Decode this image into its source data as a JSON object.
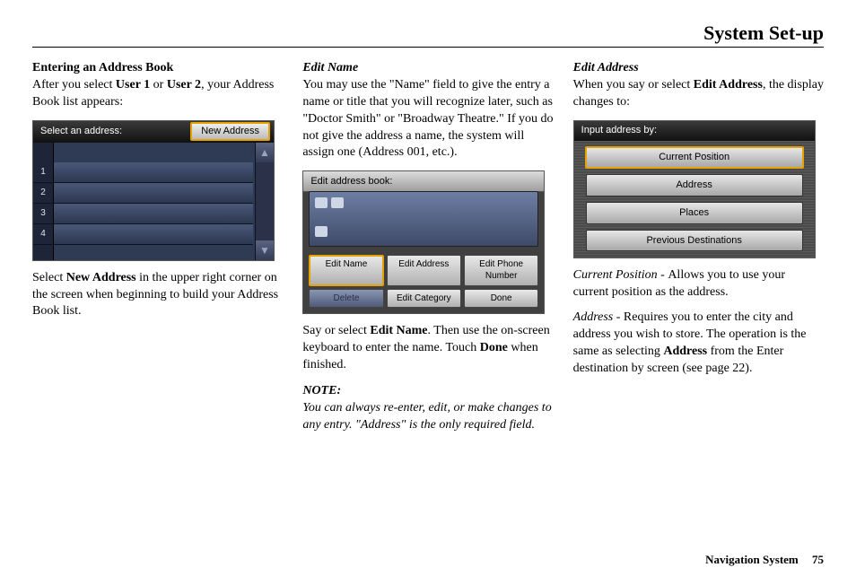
{
  "page_title": "System Set-up",
  "footer": {
    "label": "Navigation System",
    "page": "75"
  },
  "col1": {
    "heading": "Entering an Address Book",
    "p1a": "After you select ",
    "p1_b1": "User 1",
    "p1_or": " or ",
    "p1_b2": "User 2",
    "p1b": ", your Address Book list appears:",
    "p2a": "Select ",
    "p2_b": "New Address",
    "p2b": " in the upper right corner on the screen when beginning to build your Address Book list.",
    "shot": {
      "title": "Select an address:",
      "new_btn": "New Address",
      "rows": [
        "1",
        "2",
        "3",
        "4"
      ],
      "scroll_up": "▲",
      "scroll_down": "▼"
    }
  },
  "col2": {
    "heading": "Edit Name",
    "p1": "You may use the \"Name\" field to give the entry a name or title that you will recognize later, such as \"Doctor Smith\" or \"Broadway Theatre.\" If you do not give the address a name, the system will assign one (Address 001, etc.).",
    "p2a": "Say or select ",
    "p2_b": "Edit Name",
    "p2b": ". Then use the on-screen keyboard to enter the name. Touch ",
    "p2_b2": "Done",
    "p2c": " when finished.",
    "note_heading": "NOTE:",
    "note": "You can always re-enter, edit, or make changes to any entry. \"Address\" is the only required field.",
    "shot": {
      "title": "Edit address book:",
      "btns_row1": [
        "Edit Name",
        "Edit Address",
        "Edit Phone Number"
      ],
      "btns_row2": [
        "Delete",
        "Edit Category",
        "Done"
      ]
    }
  },
  "col3": {
    "heading": "Edit Address",
    "p1a": "When you say or select ",
    "p1_b": "Edit Address",
    "p1b": ", the display changes to:",
    "p2_i": "Current Position - ",
    "p2": "Allows you to use your current position as the address.",
    "p3_i": "Address - ",
    "p3a": "Requires you to enter the city and address you wish to store. The operation is the same as selecting ",
    "p3_b": "Address",
    "p3b": " from the ",
    "p3_span": "Enter destination by",
    "p3c": " screen (see page 22).",
    "shot": {
      "title": "Input address by:",
      "options": [
        "Current Position",
        "Address",
        "Places",
        "Previous Destinations"
      ]
    }
  }
}
